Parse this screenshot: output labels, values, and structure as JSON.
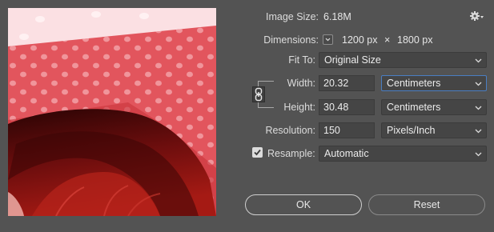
{
  "dialog": {
    "image_size_label": "Image Size:",
    "image_size_value": "6.18M",
    "dimensions_label": "Dimensions:",
    "dimensions_width": "1200 px",
    "dimensions_times": "×",
    "dimensions_height": "1800 px",
    "fit_to_label": "Fit To:",
    "fit_to_value": "Original Size",
    "width_label": "Width:",
    "width_value": "20.32",
    "width_unit": "Centimeters",
    "height_label": "Height:",
    "height_value": "30.48",
    "height_unit": "Centimeters",
    "resolution_label": "Resolution:",
    "resolution_value": "150",
    "resolution_unit": "Pixels/Inch",
    "resample_label": "Resample:",
    "resample_checked": true,
    "resample_value": "Automatic",
    "ok_label": "OK",
    "reset_label": "Reset"
  },
  "icons": {
    "settings": "gear-icon",
    "link": "chain-link-icon",
    "checkbox": "checkmark-icon",
    "dropdown": "chevron-down-icon"
  },
  "colors": {
    "background": "#535353",
    "field": "#454545",
    "focus_border": "#4a7dc2",
    "preview_pink": "#e0505a"
  }
}
